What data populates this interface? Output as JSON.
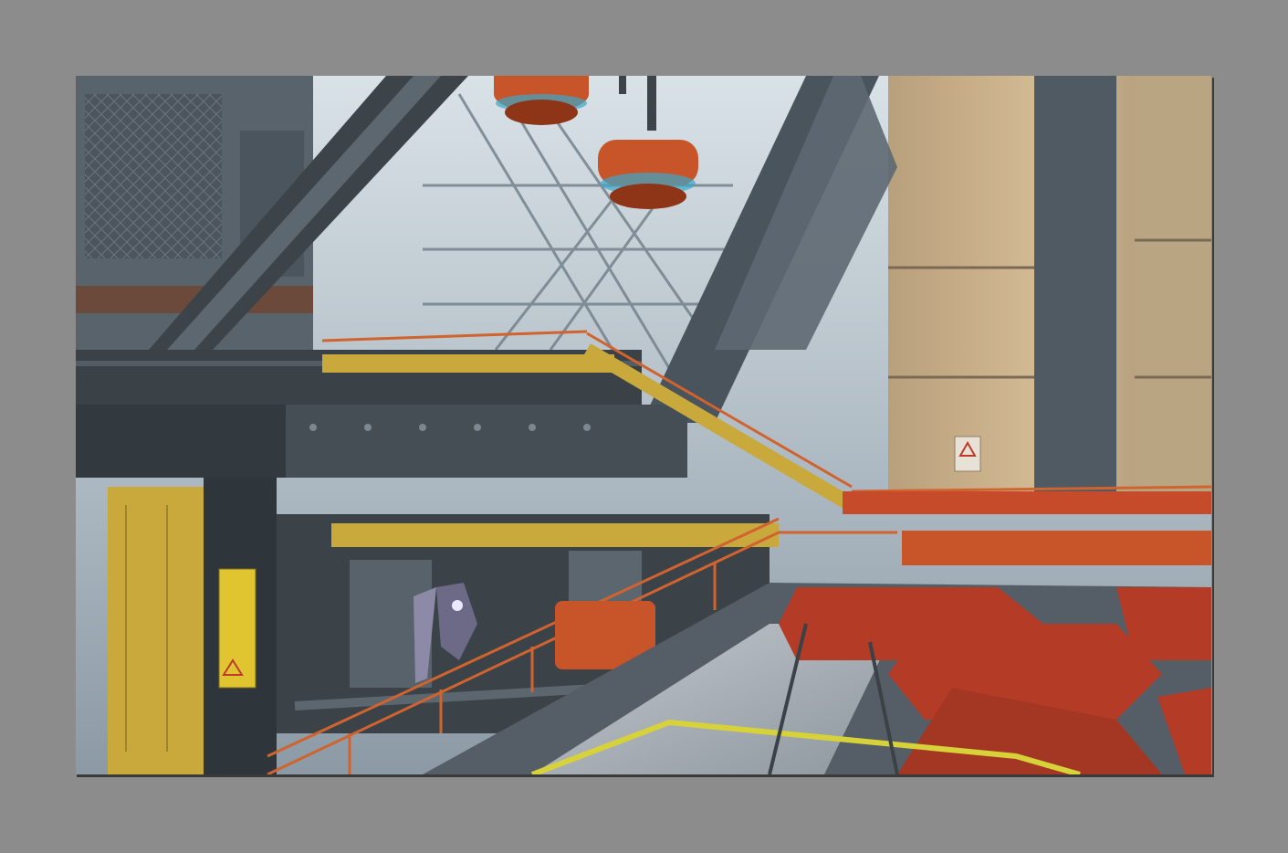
{
  "frame": {
    "background_color": "#8c8c8c",
    "border_shadow_color": "#3a3a3a"
  },
  "scene": {
    "description_kind": "game-screenshot",
    "palette": {
      "sky": "#cfd9df",
      "steel_dark": "#3c4349",
      "steel_mid": "#5d6770",
      "steel_light": "#8a96a1",
      "tower": "#c9b08a",
      "tower_shade": "#8f7f69",
      "orange": "#c8552a",
      "orange_dark": "#8e3517",
      "rail": "#d0632e",
      "yellow": "#c9a93c",
      "floor_tile": "#b43b26",
      "floor_plate": "#b9c0c6",
      "yellow_stripe": "#d8d23a"
    },
    "icons": [
      "warning-triangle-icon",
      "hazard-sign-icon",
      "mech-robot-icon"
    ]
  }
}
